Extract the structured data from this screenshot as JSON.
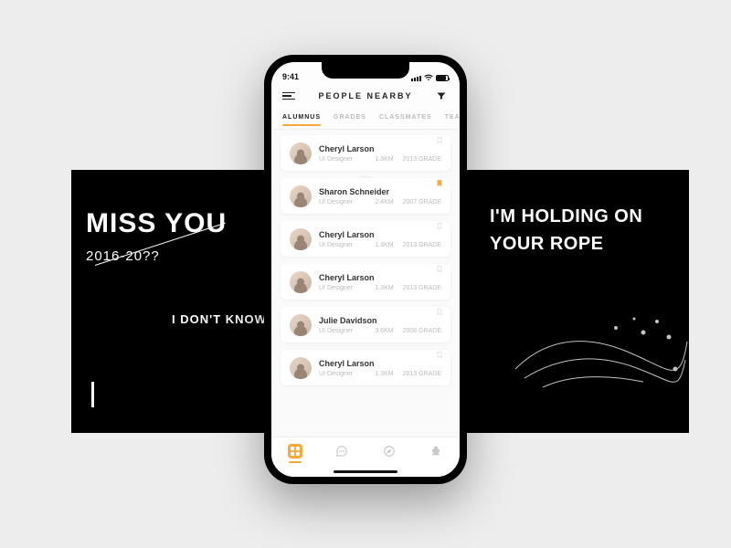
{
  "left_panel": {
    "headline": "MISS YOU",
    "years": "2016-20??",
    "sub": "I DON'T KNOW"
  },
  "right_panel": {
    "line1": "I'M HOLDING ON",
    "line2": "YOUR ROPE"
  },
  "status": {
    "time": "9:41"
  },
  "header": {
    "title": "PEOPLE NEARBY"
  },
  "tabs": [
    "ALUMNUS",
    "GRADES",
    "CLASSMATES",
    "TEACHERS"
  ],
  "active_tab_index": 0,
  "grade_label": "GRADE",
  "people": [
    {
      "name": "Cheryl Larson",
      "role": "UI Designer",
      "distance": "1.3KM",
      "year": "2013",
      "bookmarked": false
    },
    {
      "name": "Sharon Schneider",
      "role": "UI Designer",
      "distance": "2.4KM",
      "year": "2007",
      "bookmarked": true
    },
    {
      "name": "Cheryl Larson",
      "role": "UI Designer",
      "distance": "1.3KM",
      "year": "2013",
      "bookmarked": false
    },
    {
      "name": "Cheryl Larson",
      "role": "UI Designer",
      "distance": "1.3KM",
      "year": "2013",
      "bookmarked": false
    },
    {
      "name": "Julie Davidson",
      "role": "UI Designer",
      "distance": "3.6KM",
      "year": "2008",
      "bookmarked": false
    },
    {
      "name": "Cheryl Larson",
      "role": "UI Designer",
      "distance": "1.3KM",
      "year": "2013",
      "bookmarked": false
    }
  ],
  "bottom_tabs": [
    {
      "icon": "grid",
      "active": true
    },
    {
      "icon": "chat",
      "active": false
    },
    {
      "icon": "compass",
      "active": false
    },
    {
      "icon": "club",
      "active": false
    }
  ],
  "colors": {
    "accent": "#f4a93a"
  }
}
